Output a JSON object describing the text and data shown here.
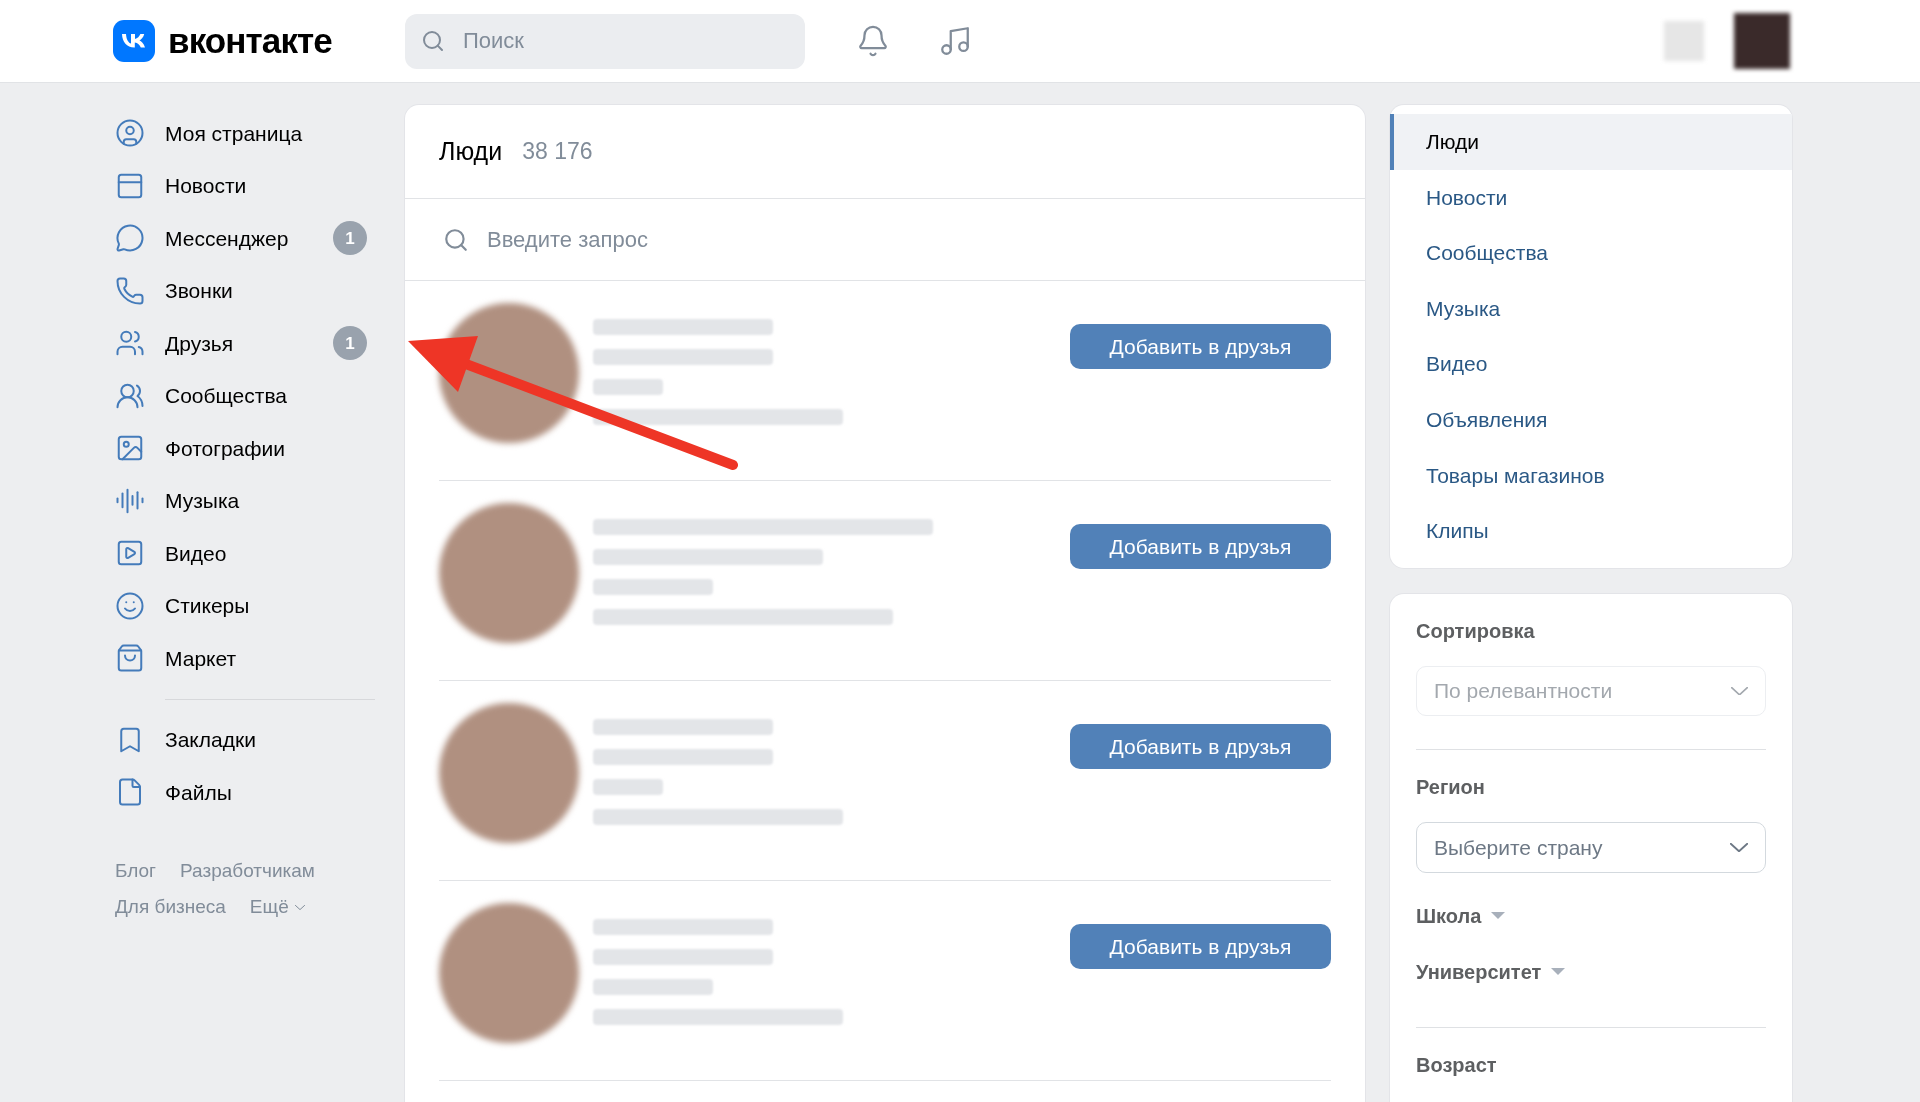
{
  "header": {
    "logo_text": "вконтакте",
    "search": {
      "placeholder": "Поиск"
    }
  },
  "nav": {
    "main": [
      {
        "label": "Моя страница"
      },
      {
        "label": "Новости"
      },
      {
        "label": "Мессенджер",
        "badge": "1"
      },
      {
        "label": "Звонки"
      },
      {
        "label": "Друзья",
        "badge": "1"
      },
      {
        "label": "Сообщества"
      },
      {
        "label": "Фотографии"
      },
      {
        "label": "Музыка"
      },
      {
        "label": "Видео"
      },
      {
        "label": "Стикеры"
      },
      {
        "label": "Маркет"
      }
    ],
    "secondary": [
      {
        "label": "Закладки"
      },
      {
        "label": "Файлы"
      }
    ],
    "footer_links": [
      "Блог",
      "Разработчикам",
      "Для бизнеса",
      "Ещё"
    ]
  },
  "people": {
    "title": "Люди",
    "count": "38 176",
    "search": {
      "placeholder": "Введите запрос"
    },
    "rows": [
      {
        "button": "Добавить в друзья"
      },
      {
        "button": "Добавить в друзья"
      },
      {
        "button": "Добавить в друзья"
      },
      {
        "button": "Добавить в друзья"
      }
    ]
  },
  "section_menu": [
    {
      "label": "Люди",
      "selected": true
    },
    {
      "label": "Новости",
      "selected": false
    },
    {
      "label": "Сообщества",
      "selected": false
    },
    {
      "label": "Музыка",
      "selected": false
    },
    {
      "label": "Видео",
      "selected": false
    },
    {
      "label": "Объявления",
      "selected": false
    },
    {
      "label": "Товары магазинов",
      "selected": false
    },
    {
      "label": "Клипы",
      "selected": false
    }
  ],
  "filters": {
    "sort": {
      "title": "Сортировка",
      "value": "По релевантности",
      "disabled": true
    },
    "region": {
      "title": "Регион",
      "placeholder": "Выберите страну",
      "disabled": false
    },
    "expanders": [
      "Школа",
      "Университет"
    ],
    "age": {
      "title": "Возраст"
    }
  }
}
